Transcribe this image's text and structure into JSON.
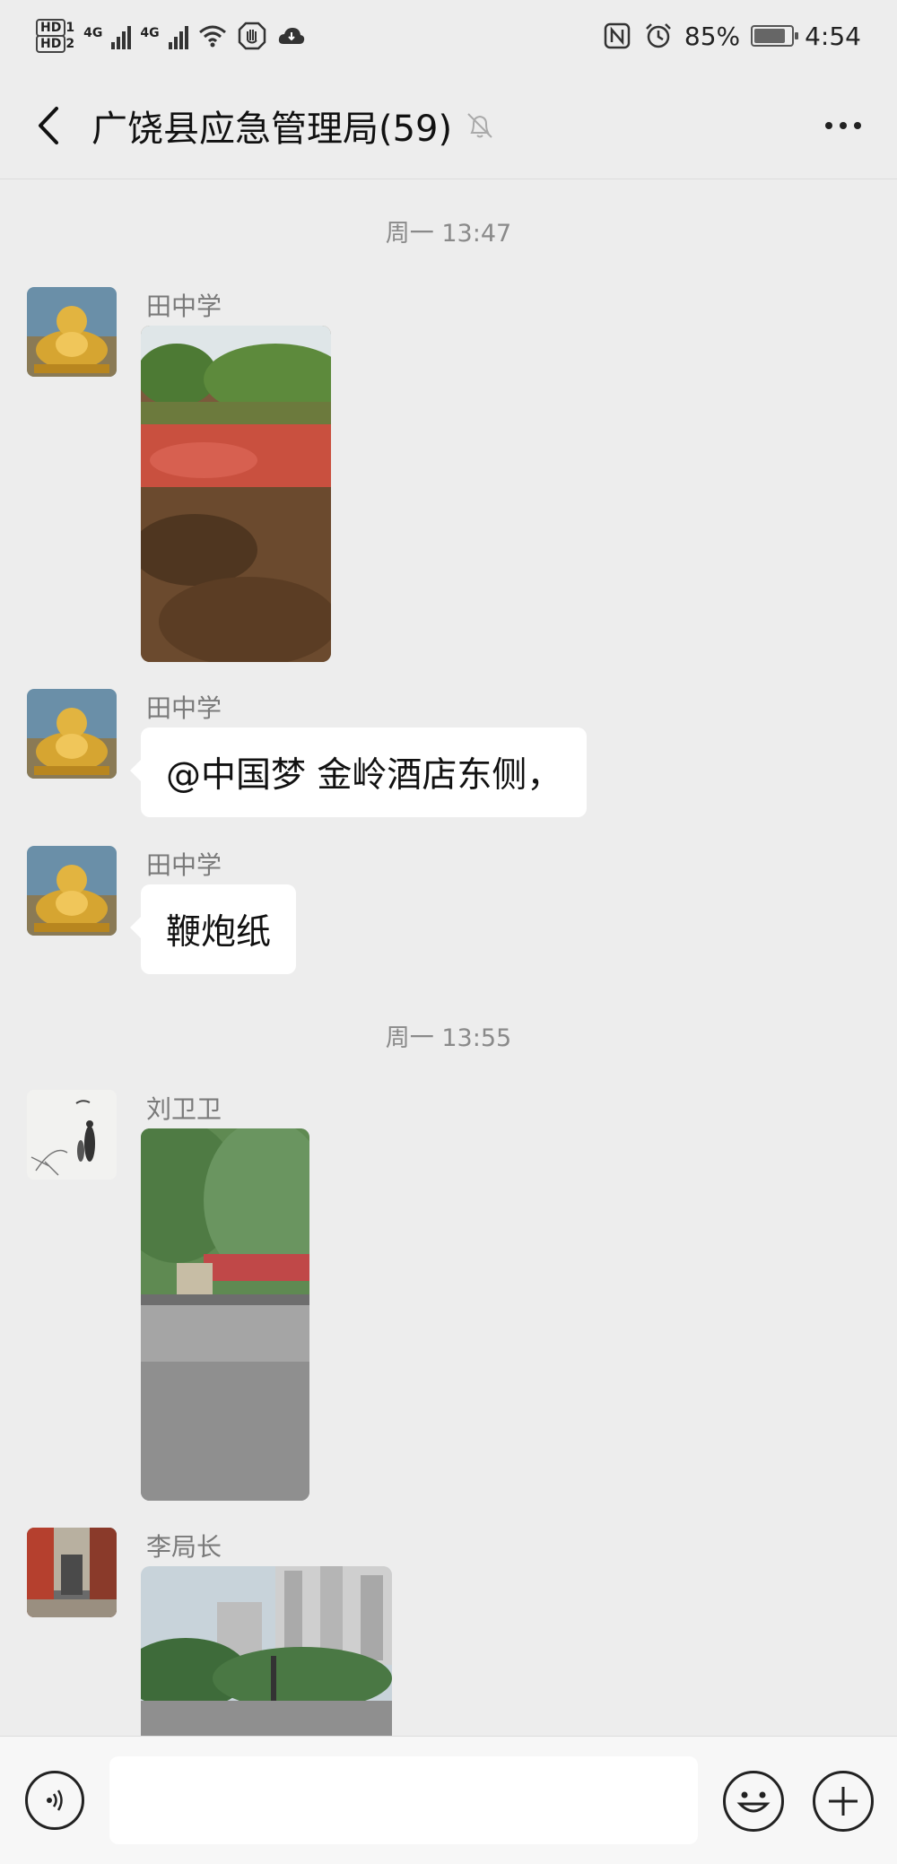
{
  "status_bar": {
    "hd1": "HD",
    "hd1_sub": "1",
    "hd2": "HD",
    "hd2_sub": "2",
    "net1": "4G",
    "net2": "4G",
    "battery_text": "85%",
    "battery_level": 0.85,
    "time": "4:54",
    "icons": [
      "nfc-icon",
      "alarm-icon",
      "wifi-icon",
      "hand-icon",
      "cloud-icon"
    ]
  },
  "header": {
    "title": "广饶县应急管理局(59)",
    "back_icon": "chevron-left-icon",
    "mute_icon": "bell-off-icon",
    "more_icon": "more-icon"
  },
  "chat": {
    "time_1": "周一 13:47",
    "time_2": "周一 13:55",
    "messages": [
      {
        "sender": "田中学",
        "type": "image",
        "content": "photo-red-debris"
      },
      {
        "sender": "田中学",
        "type": "text",
        "content": "@中国梦  金岭酒店东侧，"
      },
      {
        "sender": "田中学",
        "type": "text",
        "content": "鞭炮纸"
      },
      {
        "sender": "刘卫卫",
        "type": "image",
        "content": "photo-roadside-trees"
      },
      {
        "sender": "李局长",
        "type": "image",
        "content": "photo-city-buildings"
      }
    ]
  },
  "input_bar": {
    "voice_icon": "voice-icon",
    "emoji_icon": "emoji-icon",
    "plus_icon": "plus-icon",
    "placeholder": ""
  },
  "colors": {
    "background": "#ededed",
    "bubble": "#ffffff",
    "sender_text": "#7a7a7a"
  }
}
